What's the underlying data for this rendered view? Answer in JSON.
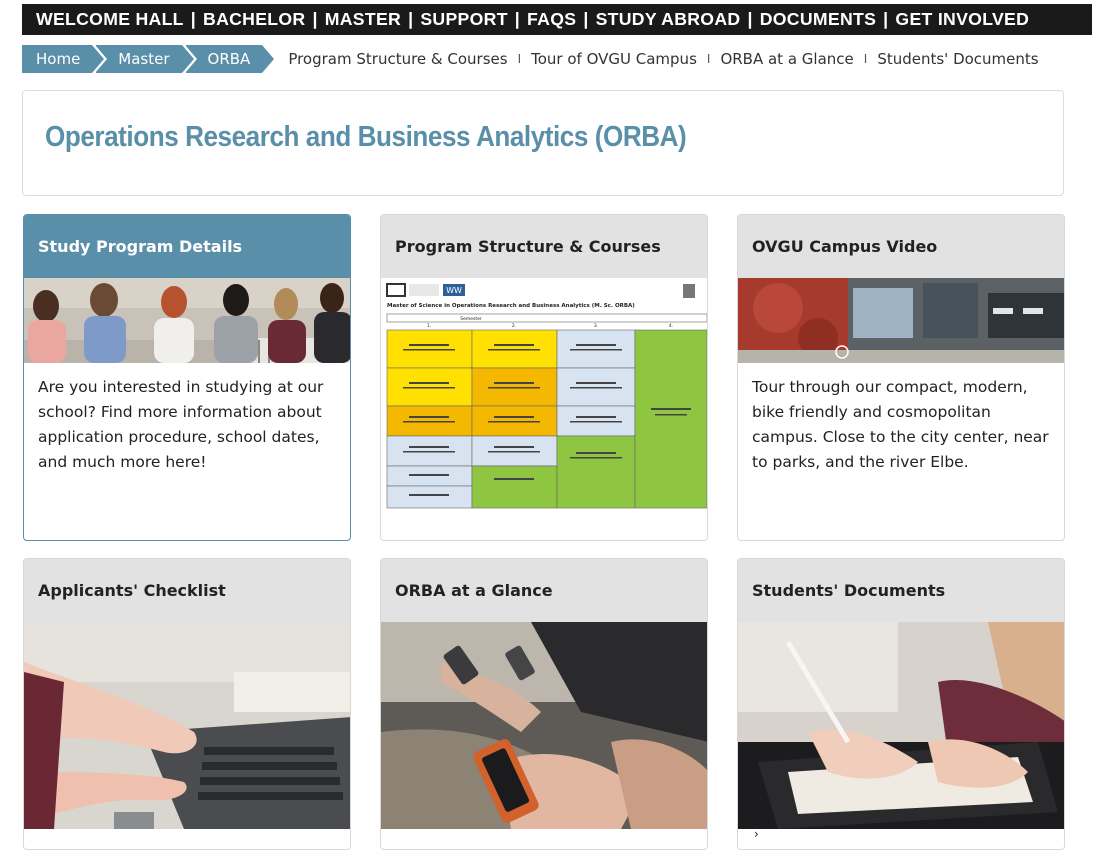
{
  "topnav": {
    "items": [
      "WELCOME HALL",
      "BACHELOR",
      "MASTER",
      "SUPPORT",
      "FAQS",
      "STUDY ABROAD",
      "DOCUMENTS",
      "GET INVOLVED"
    ],
    "separator": "|"
  },
  "breadcrumb": {
    "items": [
      "Home",
      "Master",
      "ORBA"
    ],
    "quick_links": [
      "Program Structure & Courses",
      "Tour of OVGU Campus",
      "ORBA at a Glance",
      "Students' Documents"
    ],
    "quick_sep": "I"
  },
  "page": {
    "title": "Operations Research and Business Analytics (ORBA)"
  },
  "cards": [
    {
      "title": "Study Program Details",
      "text": "Are you interested in studying at our school? Find more information about application procedure, school dates, and much more here!"
    },
    {
      "title": "Program Structure & Courses",
      "doc_title": "Master of Science in Operations Research and Business Analytics (M. Sc. ORBA)",
      "doc_header": "Semester",
      "semesters": [
        "1.",
        "2.",
        "3.",
        "4."
      ],
      "logo_text": "WW"
    },
    {
      "title": "OVGU Campus Video",
      "text": "Tour through our compact, modern, bike friendly and cosmopolitan campus. Close to the city center, near to parks, and the river Elbe."
    },
    {
      "title": "Applicants' Checklist"
    },
    {
      "title": "ORBA at a Glance"
    },
    {
      "title": "Students' Documents",
      "more": "›"
    }
  ],
  "colors": {
    "accent": "#5a8fa9",
    "nav_bg": "#1a1a1a",
    "card_header": "#e2e2e2"
  }
}
